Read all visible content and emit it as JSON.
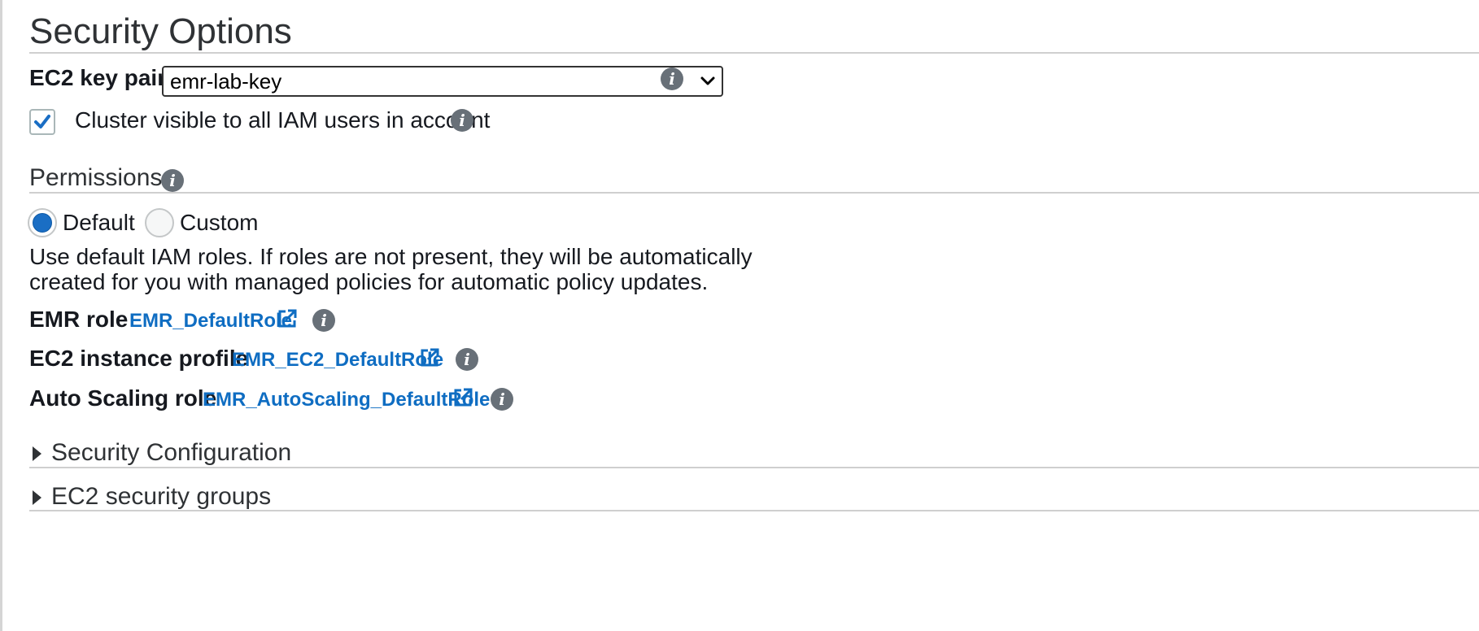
{
  "section": {
    "title": "Security Options"
  },
  "key_pair": {
    "label": "EC2 key pair",
    "selected": "emr-lab-key",
    "info_icon": "info-icon"
  },
  "visibility": {
    "label": "Cluster visible to all IAM users in account",
    "checked": true
  },
  "permissions": {
    "title": "Permissions",
    "options": [
      {
        "label": "Default",
        "selected": true
      },
      {
        "label": "Custom",
        "selected": false
      }
    ],
    "description_line1": "Use default IAM roles. If roles are not present, they will be automatically",
    "description_line2": "created for you with managed policies for automatic policy updates.",
    "roles": [
      {
        "label": "EMR role",
        "value": "EMR_DefaultRole"
      },
      {
        "label": "EC2 instance profile",
        "value": "EMR_EC2_DefaultRole"
      },
      {
        "label": "Auto Scaling role",
        "value": "EMR_AutoScaling_DefaultRole"
      }
    ]
  },
  "collapsibles": [
    {
      "label": "Security Configuration"
    },
    {
      "label": "EC2 security groups"
    }
  ],
  "colors": {
    "link": "#0f6dc2",
    "radio_selected": "#1a6ec4",
    "info_icon": "#687078"
  }
}
